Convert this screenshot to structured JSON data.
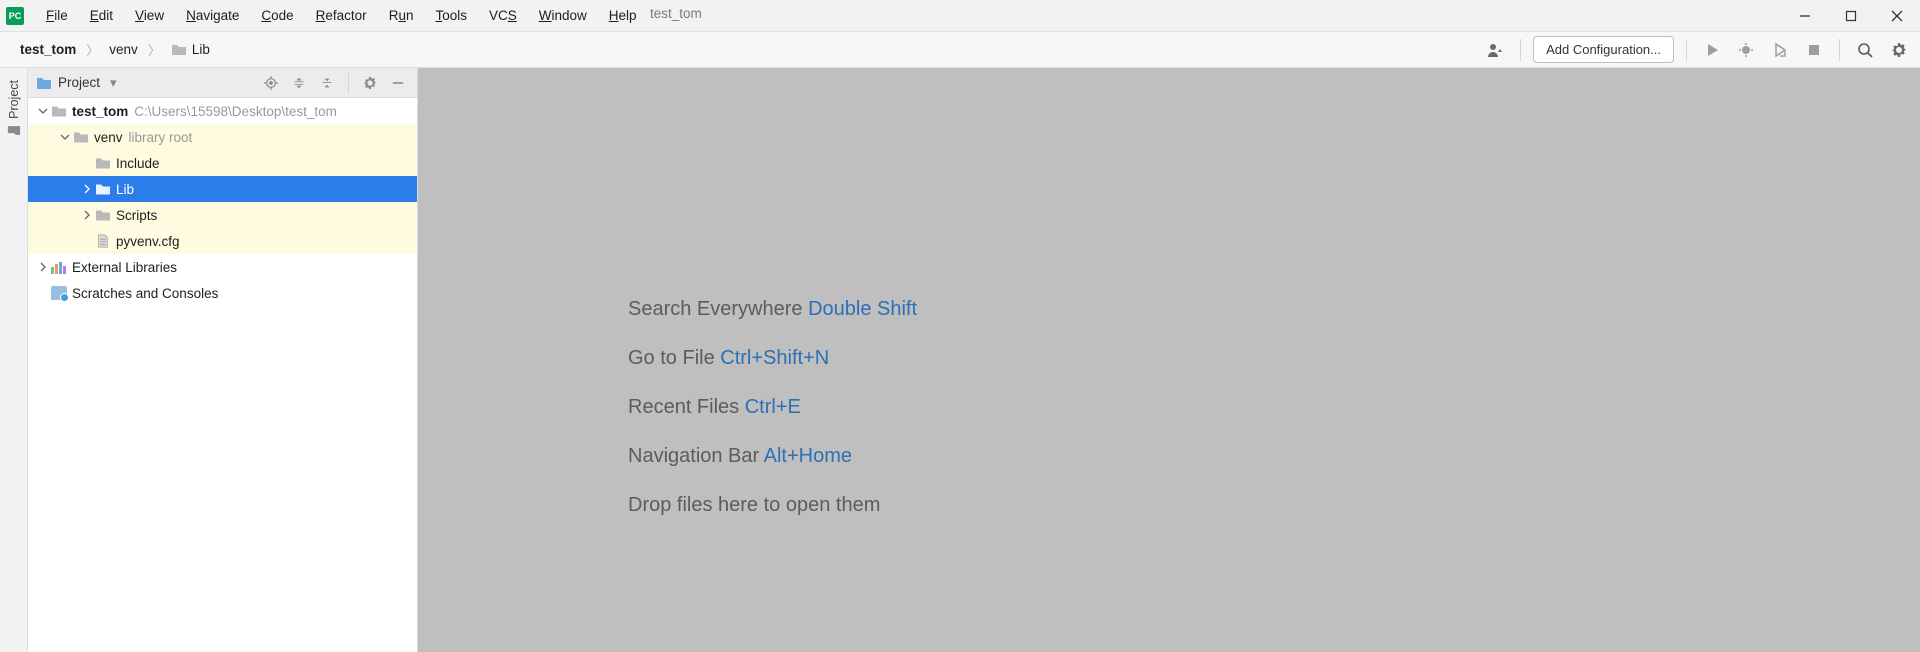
{
  "app_title": "test_tom",
  "menu": [
    "File",
    "Edit",
    "View",
    "Navigate",
    "Code",
    "Refactor",
    "Run",
    "Tools",
    "VCS",
    "Window",
    "Help"
  ],
  "breadcrumb": {
    "root": "test_tom",
    "mid": "venv",
    "leaf": "Lib"
  },
  "toolbar": {
    "add_configuration": "Add Configuration..."
  },
  "tree": {
    "header": "Project",
    "root": {
      "label": "test_tom",
      "path": "C:\\Users\\15598\\Desktop\\test_tom"
    },
    "venv": {
      "label": "venv",
      "hint": "library root"
    },
    "include": "Include",
    "lib": "Lib",
    "scripts": "Scripts",
    "pyvenv": "pyvenv.cfg",
    "external": "External Libraries",
    "scratches": "Scratches and Consoles"
  },
  "hints": {
    "l1": "Search Everywhere",
    "k1": "Double Shift",
    "l2": "Go to File",
    "k2": "Ctrl+Shift+N",
    "l3": "Recent Files",
    "k3": "Ctrl+E",
    "l4": "Navigation Bar",
    "k4": "Alt+Home",
    "l5": "Drop files here to open them"
  },
  "sidebar_tab": "Project"
}
